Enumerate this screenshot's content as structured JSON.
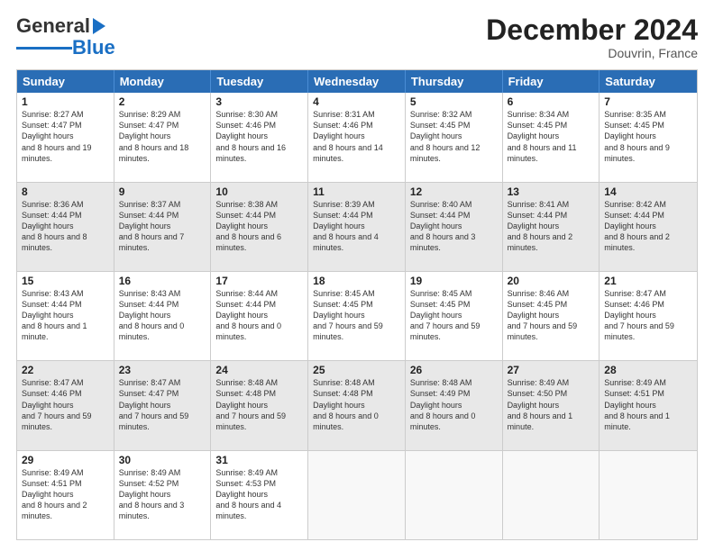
{
  "header": {
    "logo_general": "General",
    "logo_blue": "Blue",
    "month_title": "December 2024",
    "location": "Douvrin, France"
  },
  "days_of_week": [
    "Sunday",
    "Monday",
    "Tuesday",
    "Wednesday",
    "Thursday",
    "Friday",
    "Saturday"
  ],
  "weeks": [
    [
      {
        "day": "1",
        "sunrise": "8:27 AM",
        "sunset": "4:47 PM",
        "daylight": "8 hours and 19 minutes.",
        "shaded": false
      },
      {
        "day": "2",
        "sunrise": "8:29 AM",
        "sunset": "4:47 PM",
        "daylight": "8 hours and 18 minutes.",
        "shaded": false
      },
      {
        "day": "3",
        "sunrise": "8:30 AM",
        "sunset": "4:46 PM",
        "daylight": "8 hours and 16 minutes.",
        "shaded": false
      },
      {
        "day": "4",
        "sunrise": "8:31 AM",
        "sunset": "4:46 PM",
        "daylight": "8 hours and 14 minutes.",
        "shaded": false
      },
      {
        "day": "5",
        "sunrise": "8:32 AM",
        "sunset": "4:45 PM",
        "daylight": "8 hours and 12 minutes.",
        "shaded": false
      },
      {
        "day": "6",
        "sunrise": "8:34 AM",
        "sunset": "4:45 PM",
        "daylight": "8 hours and 11 minutes.",
        "shaded": false
      },
      {
        "day": "7",
        "sunrise": "8:35 AM",
        "sunset": "4:45 PM",
        "daylight": "8 hours and 9 minutes.",
        "shaded": false
      }
    ],
    [
      {
        "day": "8",
        "sunrise": "8:36 AM",
        "sunset": "4:44 PM",
        "daylight": "8 hours and 8 minutes.",
        "shaded": true
      },
      {
        "day": "9",
        "sunrise": "8:37 AM",
        "sunset": "4:44 PM",
        "daylight": "8 hours and 7 minutes.",
        "shaded": true
      },
      {
        "day": "10",
        "sunrise": "8:38 AM",
        "sunset": "4:44 PM",
        "daylight": "8 hours and 6 minutes.",
        "shaded": true
      },
      {
        "day": "11",
        "sunrise": "8:39 AM",
        "sunset": "4:44 PM",
        "daylight": "8 hours and 4 minutes.",
        "shaded": true
      },
      {
        "day": "12",
        "sunrise": "8:40 AM",
        "sunset": "4:44 PM",
        "daylight": "8 hours and 3 minutes.",
        "shaded": true
      },
      {
        "day": "13",
        "sunrise": "8:41 AM",
        "sunset": "4:44 PM",
        "daylight": "8 hours and 2 minutes.",
        "shaded": true
      },
      {
        "day": "14",
        "sunrise": "8:42 AM",
        "sunset": "4:44 PM",
        "daylight": "8 hours and 2 minutes.",
        "shaded": true
      }
    ],
    [
      {
        "day": "15",
        "sunrise": "8:43 AM",
        "sunset": "4:44 PM",
        "daylight": "8 hours and 1 minute.",
        "shaded": false
      },
      {
        "day": "16",
        "sunrise": "8:43 AM",
        "sunset": "4:44 PM",
        "daylight": "8 hours and 0 minutes.",
        "shaded": false
      },
      {
        "day": "17",
        "sunrise": "8:44 AM",
        "sunset": "4:44 PM",
        "daylight": "8 hours and 0 minutes.",
        "shaded": false
      },
      {
        "day": "18",
        "sunrise": "8:45 AM",
        "sunset": "4:45 PM",
        "daylight": "7 hours and 59 minutes.",
        "shaded": false
      },
      {
        "day": "19",
        "sunrise": "8:45 AM",
        "sunset": "4:45 PM",
        "daylight": "7 hours and 59 minutes.",
        "shaded": false
      },
      {
        "day": "20",
        "sunrise": "8:46 AM",
        "sunset": "4:45 PM",
        "daylight": "7 hours and 59 minutes.",
        "shaded": false
      },
      {
        "day": "21",
        "sunrise": "8:47 AM",
        "sunset": "4:46 PM",
        "daylight": "7 hours and 59 minutes.",
        "shaded": false
      }
    ],
    [
      {
        "day": "22",
        "sunrise": "8:47 AM",
        "sunset": "4:46 PM",
        "daylight": "7 hours and 59 minutes.",
        "shaded": true
      },
      {
        "day": "23",
        "sunrise": "8:47 AM",
        "sunset": "4:47 PM",
        "daylight": "7 hours and 59 minutes.",
        "shaded": true
      },
      {
        "day": "24",
        "sunrise": "8:48 AM",
        "sunset": "4:48 PM",
        "daylight": "7 hours and 59 minutes.",
        "shaded": true
      },
      {
        "day": "25",
        "sunrise": "8:48 AM",
        "sunset": "4:48 PM",
        "daylight": "8 hours and 0 minutes.",
        "shaded": true
      },
      {
        "day": "26",
        "sunrise": "8:48 AM",
        "sunset": "4:49 PM",
        "daylight": "8 hours and 0 minutes.",
        "shaded": true
      },
      {
        "day": "27",
        "sunrise": "8:49 AM",
        "sunset": "4:50 PM",
        "daylight": "8 hours and 1 minute.",
        "shaded": true
      },
      {
        "day": "28",
        "sunrise": "8:49 AM",
        "sunset": "4:51 PM",
        "daylight": "8 hours and 1 minute.",
        "shaded": true
      }
    ],
    [
      {
        "day": "29",
        "sunrise": "8:49 AM",
        "sunset": "4:51 PM",
        "daylight": "8 hours and 2 minutes.",
        "shaded": false
      },
      {
        "day": "30",
        "sunrise": "8:49 AM",
        "sunset": "4:52 PM",
        "daylight": "8 hours and 3 minutes.",
        "shaded": false
      },
      {
        "day": "31",
        "sunrise": "8:49 AM",
        "sunset": "4:53 PM",
        "daylight": "8 hours and 4 minutes.",
        "shaded": false
      },
      {
        "day": "",
        "sunrise": "",
        "sunset": "",
        "daylight": "",
        "shaded": false,
        "empty": true
      },
      {
        "day": "",
        "sunrise": "",
        "sunset": "",
        "daylight": "",
        "shaded": false,
        "empty": true
      },
      {
        "day": "",
        "sunrise": "",
        "sunset": "",
        "daylight": "",
        "shaded": false,
        "empty": true
      },
      {
        "day": "",
        "sunrise": "",
        "sunset": "",
        "daylight": "",
        "shaded": false,
        "empty": true
      }
    ]
  ]
}
